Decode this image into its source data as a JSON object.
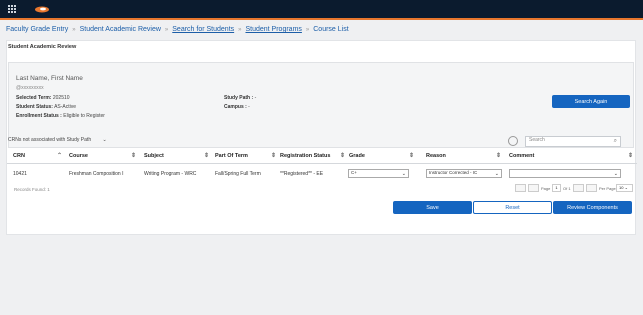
{
  "icons": {
    "apps": "grid-apps-icon",
    "logo": "orange-logo-icon"
  },
  "breadcrumb": [
    "Faculty Grade Entry",
    "Student Academic Review",
    "Search for Students",
    "Student Programs",
    "Course List"
  ],
  "breadcrumb_sep": "»",
  "page_title": "Student Academic Review",
  "student": {
    "name": "Last Name, First Name",
    "id": "@xxxxxxxxx",
    "selected_term_label": "Selected Term:",
    "selected_term": "202510",
    "status_label": "Student Status:",
    "status": "AS-Active",
    "enroll_label": "Enrollment Status :",
    "enroll": "Eligible to Register",
    "study_path_label": "Study Path :",
    "study_path": "-",
    "campus_label": "Campus :",
    "campus": "-"
  },
  "search_again": "Search Again",
  "crn_filter": "CRNs not associated with Study Path",
  "search_placeholder": "Search",
  "table": {
    "headers": [
      "CRN",
      "Course",
      "Subject",
      "Part Of Term",
      "Registration Status",
      "Grade",
      "Reason",
      "Comment"
    ],
    "row": {
      "crn": "10421",
      "course": "Freshman Composition I",
      "subject": "Writing Program - WRC",
      "part_of_term": "Fall/Spring Full Term",
      "registration_status": "**Registered** - EE",
      "grade": "C+",
      "reason": "Instructor Corrected - IC"
    }
  },
  "records_found": "Records Found: 1",
  "pager": {
    "page_label": "Page",
    "page": "1",
    "of_label": "Of 1",
    "per_page_label": "Per Page",
    "per_page": "10"
  },
  "buttons": {
    "save": "Save",
    "reset": "Reset",
    "review": "Review Components"
  },
  "colors": {
    "header_bg": "#0b1b2e",
    "accent": "#e8772e",
    "primary": "#1565c0"
  }
}
